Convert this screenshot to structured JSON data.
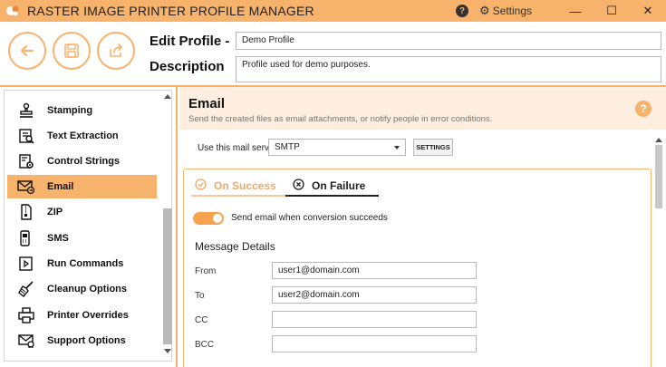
{
  "window": {
    "title": "RASTER IMAGE PRINTER PROFILE MANAGER",
    "settings_label": "Settings",
    "help_glyph": "?",
    "minimize_glyph": "—",
    "maximize_glyph": "☐",
    "close_glyph": "✕"
  },
  "header": {
    "edit_profile_label": "Edit Profile -",
    "description_label": "Description",
    "profile_name": "Demo Profile",
    "description_value": "Profile used for demo purposes."
  },
  "sidebar": {
    "items": [
      {
        "label": "Stamping",
        "icon": "stamp-icon"
      },
      {
        "label": "Text Extraction",
        "icon": "text-extraction-icon"
      },
      {
        "label": "Control Strings",
        "icon": "control-strings-icon"
      },
      {
        "label": "Email",
        "icon": "email-icon",
        "active": true
      },
      {
        "label": "ZIP",
        "icon": "zip-icon"
      },
      {
        "label": "SMS",
        "icon": "sms-icon"
      },
      {
        "label": "Run Commands",
        "icon": "run-commands-icon"
      },
      {
        "label": "Cleanup Options",
        "icon": "broom-icon"
      },
      {
        "label": "Printer Overrides",
        "icon": "printer-icon"
      },
      {
        "label": "Support Options",
        "icon": "support-icon"
      }
    ]
  },
  "main": {
    "title": "Email",
    "subtitle": "Send the created files as email attachments, or notify people in error conditions.",
    "help_glyph": "?",
    "mail_service_label": "Use this mail service",
    "mail_service_value": "SMTP",
    "settings_button": "SETTINGS",
    "tabs": [
      {
        "label": "On Success",
        "selected": false
      },
      {
        "label": "On Failure",
        "selected": true
      }
    ],
    "toggle_label": "Send email when conversion succeeds",
    "toggle_on": true,
    "section_title": "Message Details",
    "fields": [
      {
        "label": "From",
        "value": "user1@domain.com"
      },
      {
        "label": "To",
        "value": "user2@domain.com"
      },
      {
        "label": "CC",
        "value": ""
      },
      {
        "label": "BCC",
        "value": ""
      }
    ]
  },
  "colors": {
    "accent": "#f7b26b",
    "accent_light": "#fdeee0",
    "toggle": "#f7a24e"
  }
}
